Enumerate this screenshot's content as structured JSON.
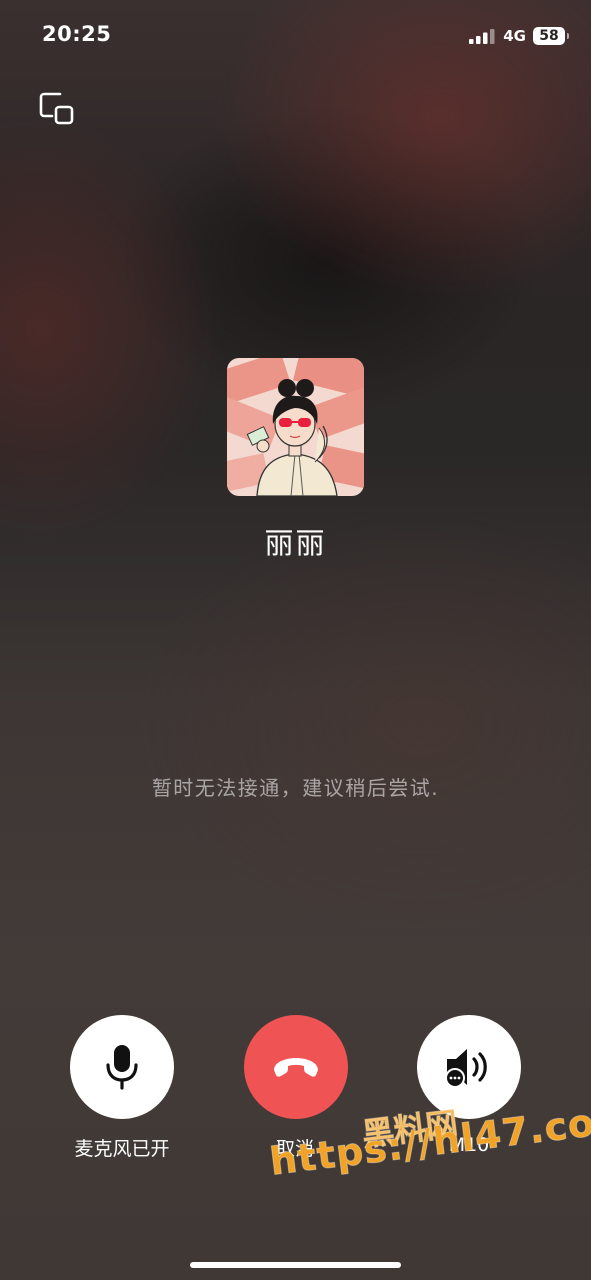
{
  "status_bar": {
    "time": "20:25",
    "network": "4G",
    "battery": "58"
  },
  "contact": {
    "name": "丽丽",
    "avatar_icon": "avatar-cartoon-girl-sunglasses"
  },
  "call": {
    "status_text": "暂时无法接通，建议稍后尝试."
  },
  "controls": {
    "microphone_label": "麦克风已开",
    "cancel_label": "取消",
    "speaker_label": "M10"
  },
  "watermark": {
    "line1": "黑料网",
    "line2": "https://hl47.co"
  },
  "colors": {
    "hangup": "#f05353",
    "watermark": "#f0a326"
  }
}
